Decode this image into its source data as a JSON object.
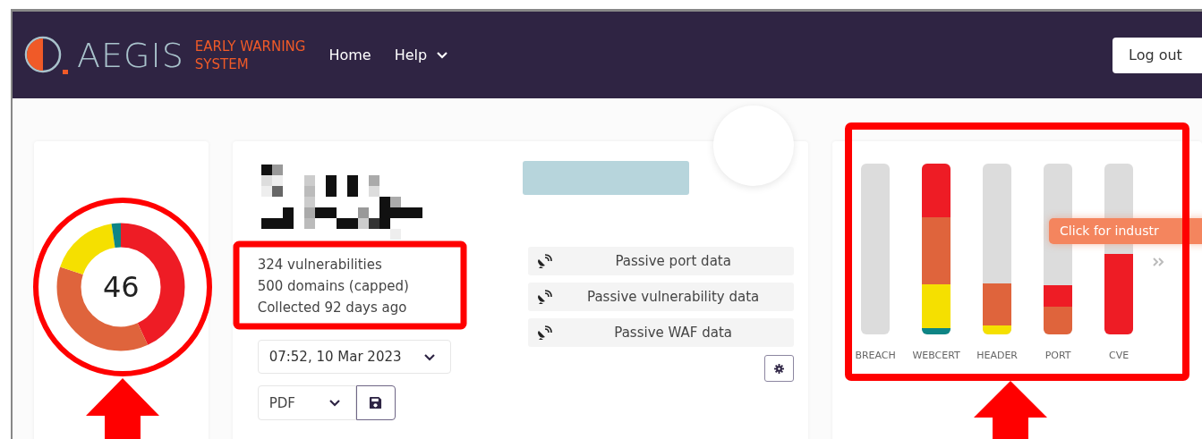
{
  "header": {
    "logo": {
      "name": "AEGIS",
      "tagline_line_1": "EARLY WARNING",
      "tagline_line_2": "SYSTEM"
    },
    "nav": [
      {
        "label": "Home",
        "dropdown": false
      },
      {
        "label": "Help",
        "dropdown": true
      }
    ],
    "logout_button": "Log out"
  },
  "score_card": {
    "score": "46"
  },
  "summary_card": {
    "stats": [
      "324 vulnerabilities",
      "500 domains (capped)",
      "Collected 92 days ago"
    ],
    "scan_date": "07:52, 10 Mar 2023",
    "export_format": "PDF",
    "data_sources": [
      "Passive port data",
      "Passive vulnerability data",
      "Passive WAF data"
    ]
  },
  "category_card": {
    "categories": [
      "BREACH",
      "WEBCERT",
      "HEADER",
      "PORT",
      "CVE"
    ],
    "tooltip": "Click for industr"
  }
}
